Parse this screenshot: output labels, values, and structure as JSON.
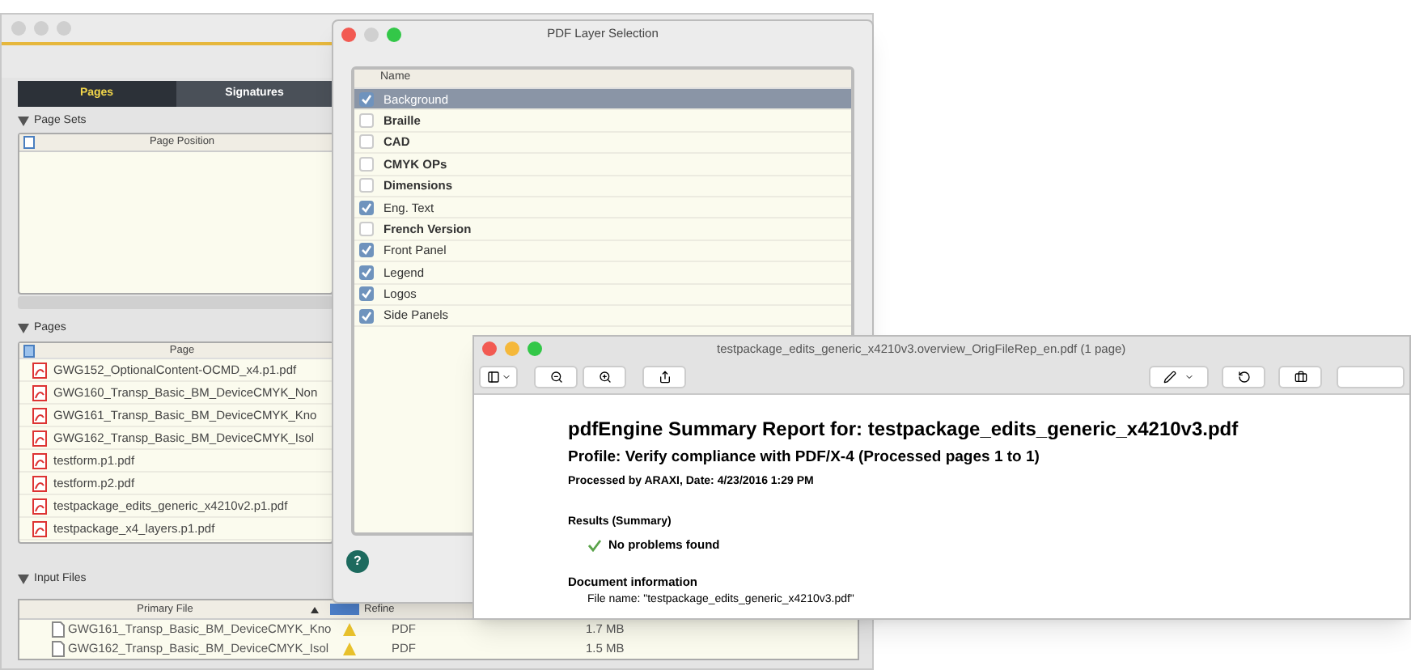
{
  "main_window": {
    "tabs": [
      {
        "label": "Pages",
        "selected": true
      },
      {
        "label": "Signatures",
        "selected": false
      }
    ],
    "page_sets": {
      "title": "Page Sets",
      "column": "Page Position"
    },
    "pages": {
      "title": "Pages",
      "column": "Page",
      "rows": [
        "GWG152_OptionalContent-OCMD_x4.p1.pdf",
        "GWG160_Transp_Basic_BM_DeviceCMYK_Non",
        "GWG161_Transp_Basic_BM_DeviceCMYK_Kno",
        "GWG162_Transp_Basic_BM_DeviceCMYK_Isol",
        "testform.p1.pdf",
        "testform.p2.pdf",
        "testpackage_edits_generic_x4210v2.p1.pdf",
        "testpackage_x4_layers.p1.pdf"
      ]
    },
    "input_files": {
      "title": "Input Files",
      "columns": [
        "Primary File",
        "Refine"
      ],
      "rows": [
        {
          "name": "GWG161_Transp_Basic_BM_DeviceCMYK_Kno",
          "format": "PDF",
          "size": "1.7 MB"
        },
        {
          "name": "GWG162_Transp_Basic_BM_DeviceCMYK_Isol",
          "format": "PDF",
          "size": "1.5 MB"
        }
      ]
    }
  },
  "layer_dialog": {
    "title": "PDF Layer Selection",
    "column": "Name",
    "help": "?",
    "layers": [
      {
        "name": "Background",
        "checked": true,
        "selected": true,
        "emphasized": false
      },
      {
        "name": "Braille",
        "checked": false,
        "selected": false,
        "emphasized": true
      },
      {
        "name": "CAD",
        "checked": false,
        "selected": false,
        "emphasized": true
      },
      {
        "name": "CMYK OPs",
        "checked": false,
        "selected": false,
        "emphasized": true
      },
      {
        "name": "Dimensions",
        "checked": false,
        "selected": false,
        "emphasized": true
      },
      {
        "name": "Eng. Text",
        "checked": true,
        "selected": false,
        "emphasized": false
      },
      {
        "name": "French Version",
        "checked": false,
        "selected": false,
        "emphasized": true
      },
      {
        "name": "Front Panel",
        "checked": true,
        "selected": false,
        "emphasized": false
      },
      {
        "name": "Legend",
        "checked": true,
        "selected": false,
        "emphasized": false
      },
      {
        "name": "Logos",
        "checked": true,
        "selected": false,
        "emphasized": false
      },
      {
        "name": "Side Panels",
        "checked": true,
        "selected": false,
        "emphasized": false
      }
    ]
  },
  "preview": {
    "title": "testpackage_edits_generic_x4210v3.overview_OrigFileRep_en.pdf (1 page)",
    "heading": "pdfEngine Summary Report for: testpackage_edits_generic_x4210v3.pdf",
    "profile": "Profile: Verify compliance with PDF/X-4 (Processed pages 1 to 1)",
    "processed": "Processed by ARAXI, Date: 4/23/2016 1:29 PM",
    "results_heading": "Results (Summary)",
    "result": "No problems found",
    "doc_heading": "Document information",
    "file_name": "File name: \"testpackage_edits_generic_x4210v3.pdf\""
  }
}
